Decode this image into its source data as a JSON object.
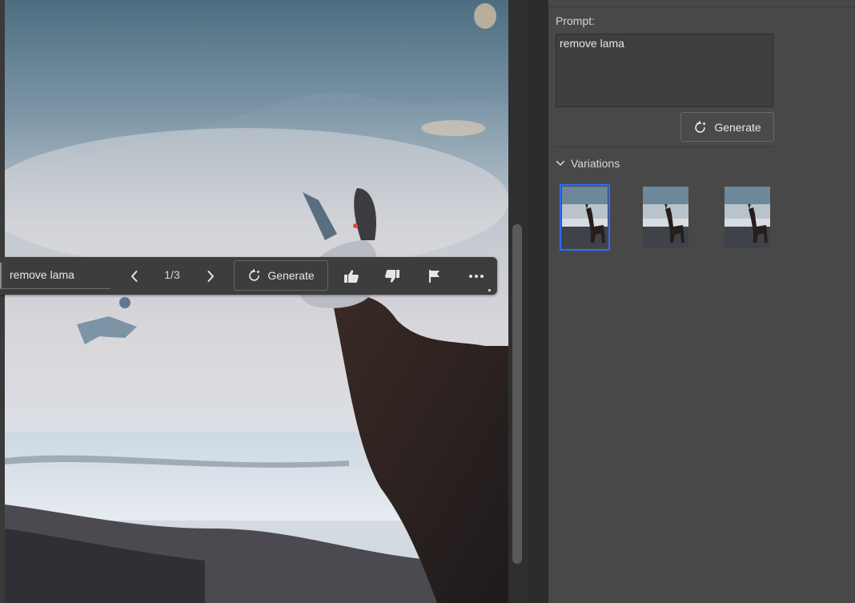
{
  "canvas": {
    "scene": "llama-photo"
  },
  "taskbar": {
    "prompt_value": "remove lama",
    "counter": "1/3",
    "generate_label": "Generate",
    "icons": {
      "prev": "chevron-left-icon",
      "next": "chevron-right-icon",
      "generate": "refresh-sparkle-icon",
      "like": "thumbs-up-icon",
      "dislike": "thumbs-down-icon",
      "report": "flag-icon",
      "more": "more-horizontal-icon"
    }
  },
  "panel": {
    "prompt_label": "Prompt:",
    "prompt_value": "remove lama",
    "generate_label": "Generate",
    "variations_label": "Variations",
    "variations": [
      {
        "selected": true
      },
      {
        "selected": false
      },
      {
        "selected": false
      }
    ],
    "colors": {
      "selection_outline": "#2f6bff",
      "panel_bg": "#484848"
    }
  }
}
